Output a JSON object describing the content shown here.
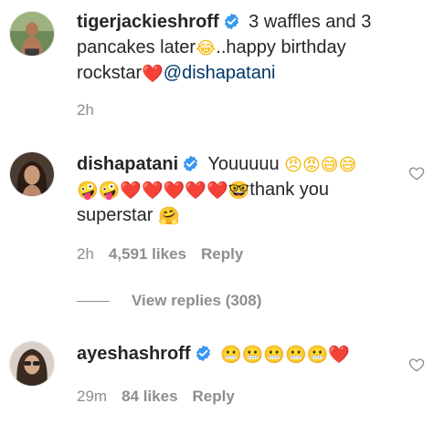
{
  "comments": [
    {
      "username": "tigerjackieshroff",
      "text_parts": [
        {
          "type": "text",
          "value": "3 waffles and 3 pancakes later"
        },
        {
          "type": "emoji",
          "value": "😂"
        },
        {
          "type": "text",
          "value": "..happy birthday rockstar"
        },
        {
          "type": "emoji",
          "value": "❤️"
        },
        {
          "type": "mention",
          "value": "@dishapatani"
        }
      ],
      "time": "2h"
    },
    {
      "username": "dishapatani",
      "text_parts": [
        {
          "type": "text",
          "value": "Youuuuu"
        },
        {
          "type": "emoji",
          "value": "😠😡😅😅"
        },
        {
          "type": "emoji",
          "value": "🤪🤪❤️❤️❤️❤️❤️🤓"
        },
        {
          "type": "text",
          "value": "thank you superstar"
        },
        {
          "type": "emoji",
          "value": "🤗"
        }
      ],
      "time": "2h",
      "likes": "4,591 likes",
      "reply": "Reply"
    },
    {
      "username": "ayeshashroff",
      "text_parts": [
        {
          "type": "emoji",
          "value": "😬😬😬😬😬❤️"
        }
      ],
      "time": "29m",
      "likes": "84 likes",
      "reply": "Reply"
    }
  ],
  "view_replies": "View replies (308)",
  "colors": {
    "text": "#262626",
    "meta": "#8e8e8e",
    "mention": "#00376b",
    "verified": "#3897f0"
  },
  "icons": {
    "verified": "verified-badge-icon",
    "like": "heart-outline-icon"
  }
}
